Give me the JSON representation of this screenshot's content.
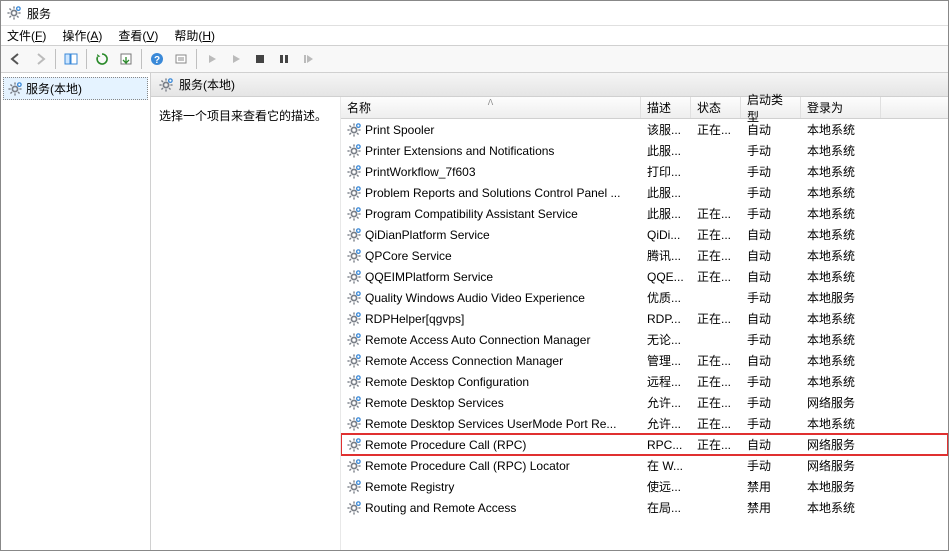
{
  "title": "服务",
  "menus": [
    "文件(F)",
    "操作(A)",
    "查看(V)",
    "帮助(H)"
  ],
  "tree_root": "服务(本地)",
  "main_header": "服务(本地)",
  "desc_prompt": "选择一个项目来查看它的描述。",
  "columns": {
    "name": "名称",
    "desc": "描述",
    "status": "状态",
    "start": "启动类型",
    "login": "登录为"
  },
  "rows": [
    {
      "name": "Print Spooler",
      "desc": "该服...",
      "status": "正在...",
      "start": "自动",
      "login": "本地系统"
    },
    {
      "name": "Printer Extensions and Notifications",
      "desc": "此服...",
      "status": "",
      "start": "手动",
      "login": "本地系统"
    },
    {
      "name": "PrintWorkflow_7f603",
      "desc": "打印...",
      "status": "",
      "start": "手动",
      "login": "本地系统"
    },
    {
      "name": "Problem Reports and Solutions Control Panel ...",
      "desc": "此服...",
      "status": "",
      "start": "手动",
      "login": "本地系统"
    },
    {
      "name": "Program Compatibility Assistant Service",
      "desc": "此服...",
      "status": "正在...",
      "start": "手动",
      "login": "本地系统"
    },
    {
      "name": "QiDianPlatform Service",
      "desc": "QiDi...",
      "status": "正在...",
      "start": "自动",
      "login": "本地系统"
    },
    {
      "name": "QPCore Service",
      "desc": "腾讯...",
      "status": "正在...",
      "start": "自动",
      "login": "本地系统"
    },
    {
      "name": "QQEIMPlatform Service",
      "desc": "QQE...",
      "status": "正在...",
      "start": "自动",
      "login": "本地系统"
    },
    {
      "name": "Quality Windows Audio Video Experience",
      "desc": "优质...",
      "status": "",
      "start": "手动",
      "login": "本地服务"
    },
    {
      "name": "RDPHelper[qgvps]",
      "desc": "RDP...",
      "status": "正在...",
      "start": "自动",
      "login": "本地系统"
    },
    {
      "name": "Remote Access Auto Connection Manager",
      "desc": "无论...",
      "status": "",
      "start": "手动",
      "login": "本地系统"
    },
    {
      "name": "Remote Access Connection Manager",
      "desc": "管理...",
      "status": "正在...",
      "start": "自动",
      "login": "本地系统"
    },
    {
      "name": "Remote Desktop Configuration",
      "desc": "远程...",
      "status": "正在...",
      "start": "手动",
      "login": "本地系统"
    },
    {
      "name": "Remote Desktop Services",
      "desc": "允许...",
      "status": "正在...",
      "start": "手动",
      "login": "网络服务"
    },
    {
      "name": "Remote Desktop Services UserMode Port Re...",
      "desc": "允许...",
      "status": "正在...",
      "start": "手动",
      "login": "本地系统"
    },
    {
      "name": "Remote Procedure Call (RPC)",
      "desc": "RPC...",
      "status": "正在...",
      "start": "自动",
      "login": "网络服务",
      "hl": true
    },
    {
      "name": "Remote Procedure Call (RPC) Locator",
      "desc": "在 W...",
      "status": "",
      "start": "手动",
      "login": "网络服务"
    },
    {
      "name": "Remote Registry",
      "desc": "使远...",
      "status": "",
      "start": "禁用",
      "login": "本地服务"
    },
    {
      "name": "Routing and Remote Access",
      "desc": "在局...",
      "status": "",
      "start": "禁用",
      "login": "本地系统"
    }
  ]
}
